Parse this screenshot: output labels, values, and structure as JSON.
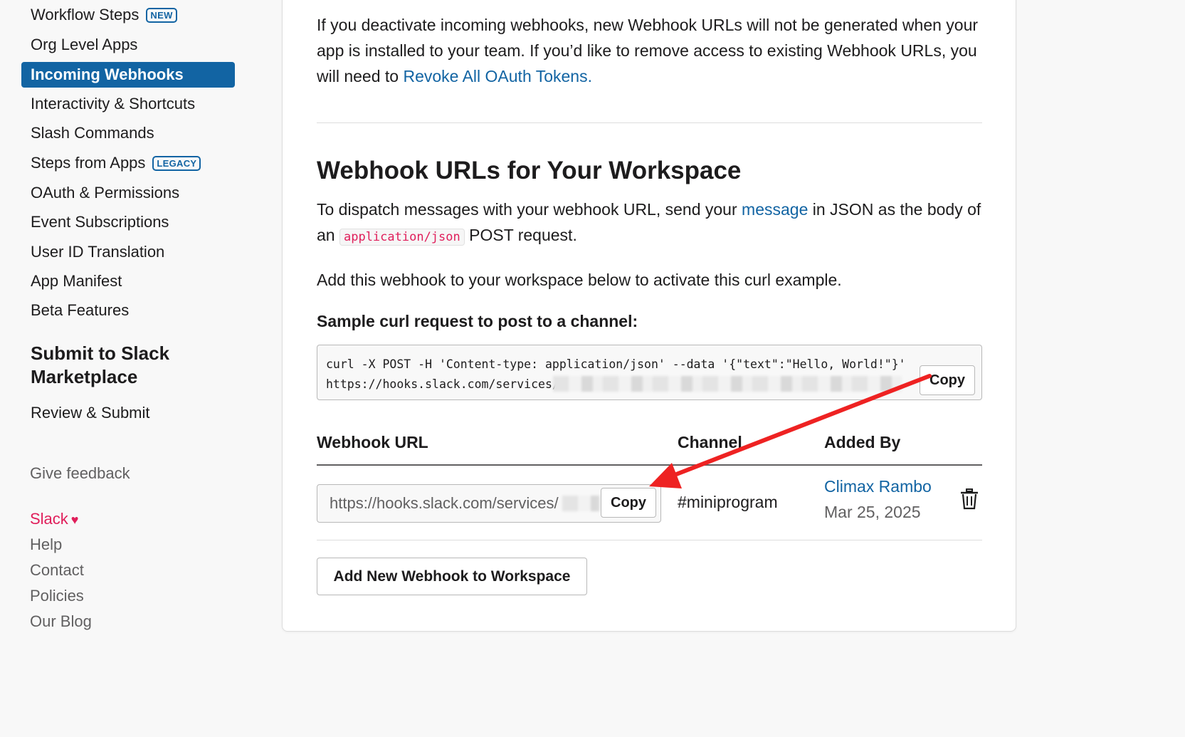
{
  "sidebar": {
    "items": [
      {
        "label": "Workflow Steps",
        "tag": "NEW"
      },
      {
        "label": "Org Level Apps"
      },
      {
        "label": "Incoming Webhooks",
        "active": true
      },
      {
        "label": "Interactivity & Shortcuts"
      },
      {
        "label": "Slash Commands"
      },
      {
        "label": "Steps from Apps",
        "tag": "LEGACY"
      },
      {
        "label": "OAuth & Permissions"
      },
      {
        "label": "Event Subscriptions"
      },
      {
        "label": "User ID Translation"
      },
      {
        "label": "App Manifest"
      },
      {
        "label": "Beta Features"
      }
    ],
    "section_title": "Submit to Slack Marketplace",
    "section_items": [
      {
        "label": "Review & Submit"
      }
    ],
    "feedback": "Give feedback",
    "footer": {
      "slack": "Slack",
      "links": [
        "Help",
        "Contact",
        "Policies",
        "Our Blog"
      ]
    }
  },
  "main": {
    "deactivate_text": "If you deactivate incoming webhooks, new Webhook URLs will not be generated when your app is installed to your team. If you’d like to remove access to existing Webhook URLs, you will need to",
    "revoke_link": "Revoke All OAuth Tokens.",
    "heading": "Webhook URLs for Your Workspace",
    "dispatch_pre": "To dispatch messages with your webhook URL, send your",
    "dispatch_link": "message",
    "dispatch_mid": "in JSON as the body of an",
    "dispatch_code": "application/json",
    "dispatch_post": "POST request.",
    "add_text": "Add this webhook to your workspace below to activate this curl example.",
    "sample_label": "Sample curl request to post to a channel:",
    "curl_line1": "curl -X POST -H 'Content-type: application/json' --data '{\"text\":\"Hello, World!\"}'",
    "curl_line2": "https://hooks.slack.com/services/",
    "copy_label": "Copy",
    "table": {
      "headers": [
        "Webhook URL",
        "Channel",
        "Added By"
      ],
      "rows": [
        {
          "url": "https://hooks.slack.com/services/",
          "channel": "#miniprogram",
          "added_by": "Climax Rambo",
          "date": "Mar 25, 2025"
        }
      ]
    },
    "add_button": "Add New Webhook to Workspace"
  },
  "colors": {
    "accent": "#1264a3",
    "slack_pink": "#e01e5a",
    "arrow": "#ee2222"
  }
}
